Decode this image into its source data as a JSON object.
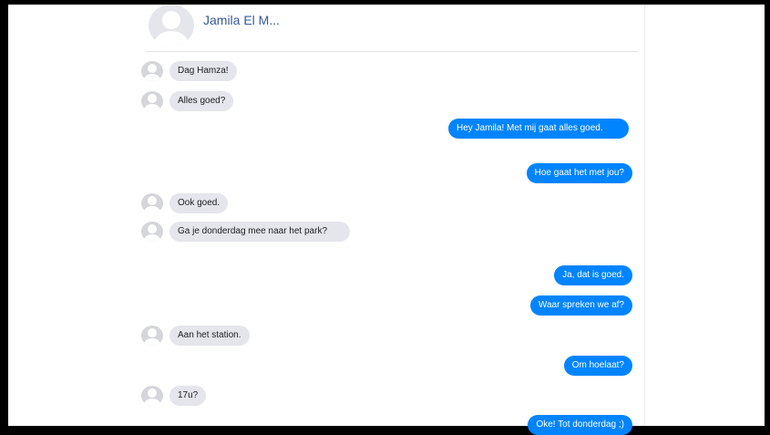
{
  "header": {
    "name": "Jamila El M..."
  },
  "messages": [
    {
      "dir": "in",
      "text": "Dag Hamza!"
    },
    {
      "dir": "in",
      "text": "Alles goed?"
    },
    {
      "dir": "out",
      "text": "Hey Jamila! Met mij gaat alles goed."
    },
    {
      "dir": "out",
      "text": "Hoe gaat het met jou?"
    },
    {
      "dir": "in",
      "text": "Ook goed."
    },
    {
      "dir": "in",
      "text": "Ga je donderdag mee naar het park?"
    },
    {
      "dir": "out",
      "text": "Ja, dat is goed."
    },
    {
      "dir": "out",
      "text": "Waar spreken we af?"
    },
    {
      "dir": "in",
      "text": "Aan het station."
    },
    {
      "dir": "out",
      "text": "Om hoelaat?"
    },
    {
      "dir": "in",
      "text": "17u?"
    },
    {
      "dir": "out",
      "text": "Oke! Tot donderdag ;)"
    }
  ],
  "colors": {
    "outgoing_bubble": "#0084ff",
    "incoming_bubble": "#e4e6eb",
    "name_link": "#385898"
  },
  "icons": {
    "avatar": "person-silhouette-icon"
  }
}
